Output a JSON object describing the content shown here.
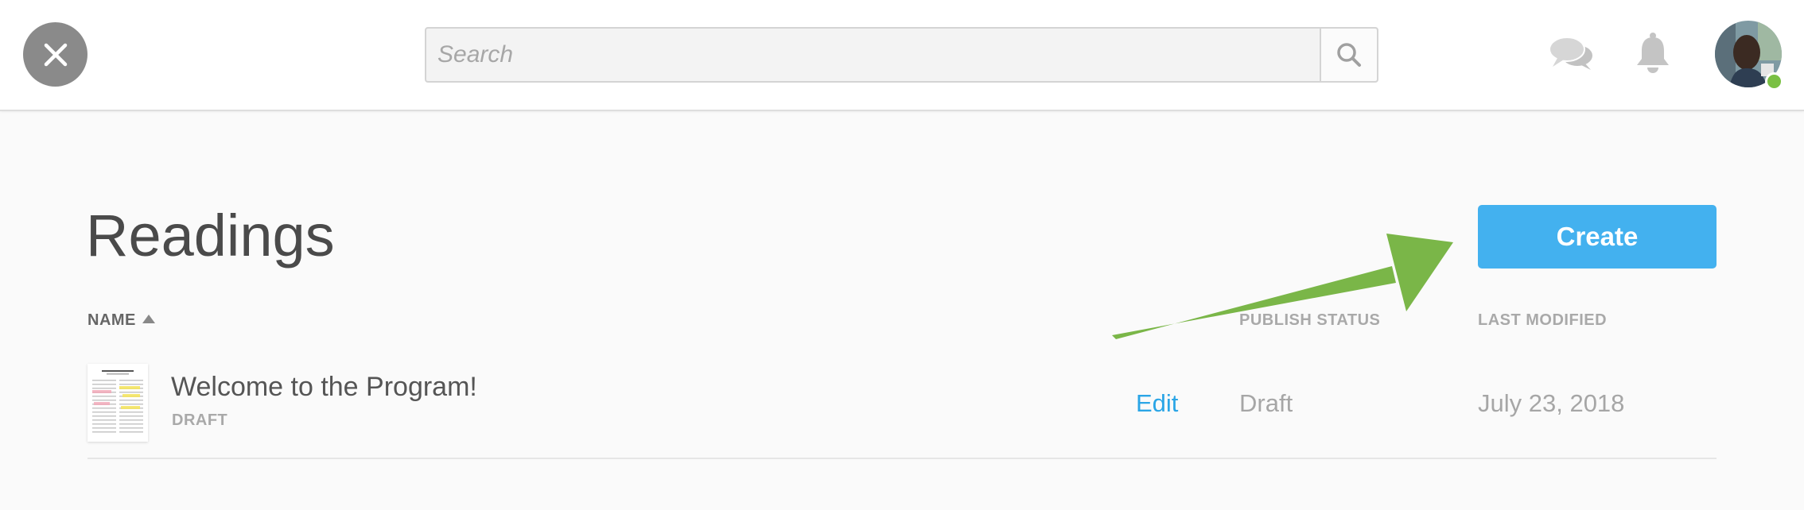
{
  "header": {
    "close_icon": "close-icon",
    "search": {
      "placeholder": "Search",
      "value": ""
    },
    "icons": [
      "search-icon",
      "chat-icon",
      "bell-icon"
    ],
    "avatar": {
      "status": "online",
      "status_color": "#7ac043"
    }
  },
  "main": {
    "title": "Readings",
    "create_label": "Create",
    "columns": {
      "name": "NAME",
      "publish_status": "PUBLISH STATUS",
      "last_modified": "LAST MODIFIED"
    },
    "sort": {
      "column": "name",
      "direction": "ascending"
    },
    "rows": [
      {
        "title": "Welcome to the Program!",
        "subtitle": "DRAFT",
        "edit_label": "Edit",
        "status": "Draft",
        "modified": "July 23, 2018"
      }
    ]
  },
  "annotation": {
    "type": "arrow",
    "color": "#7ab648",
    "points_to": "create-button"
  },
  "colors": {
    "accent": "#43b1ef",
    "link": "#2aa5e6",
    "arrow": "#7ab648"
  }
}
